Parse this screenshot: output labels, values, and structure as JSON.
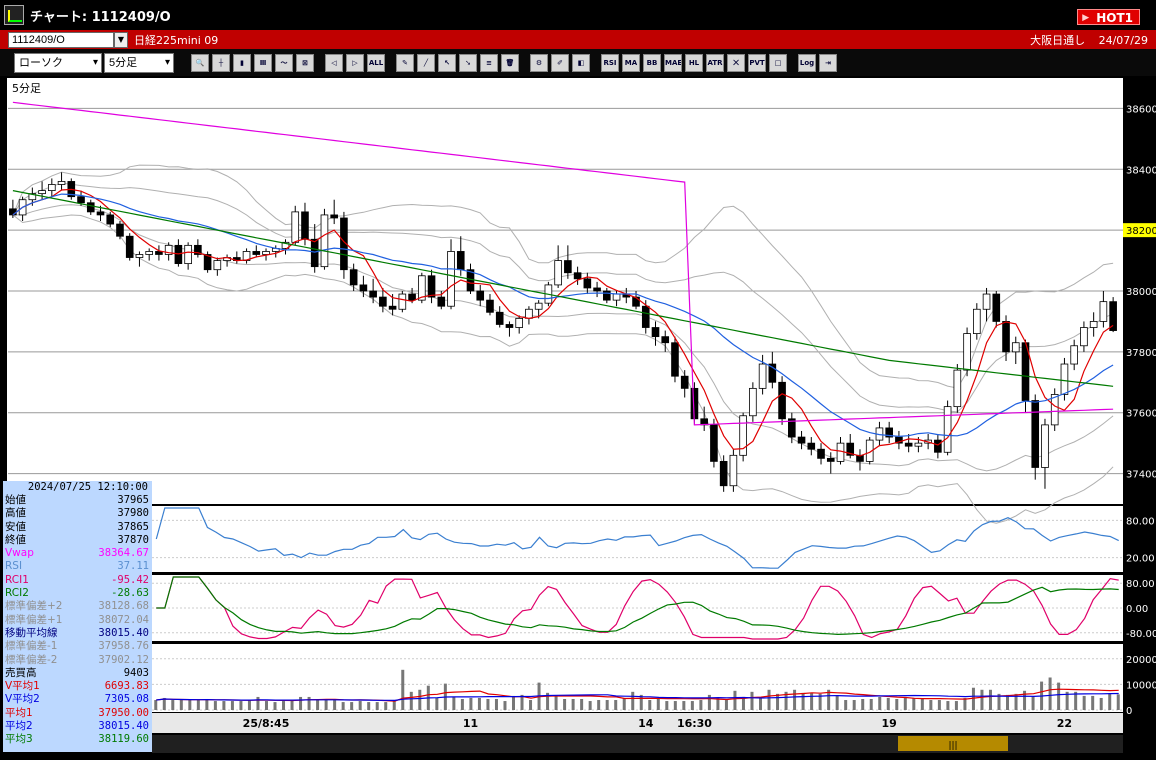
{
  "window": {
    "title": "チャート: 1112409/O",
    "hot_label": "HOT1"
  },
  "symbol_bar": {
    "code": "1112409/O",
    "name": "日経225mini 09",
    "session": "大阪日通し",
    "date": "24/07/29"
  },
  "toolbar": {
    "chart_type": "ローソク",
    "interval": "5分足",
    "buttons": [
      "zoom",
      "cross",
      "candle",
      "bar",
      "line",
      "lock",
      "cutL",
      "cutR",
      "ALL",
      "pen",
      "line-tool",
      "cursor",
      "arrow",
      "memo",
      "trash",
      "gear",
      "brush",
      "color",
      "RSI",
      "MA",
      "BB",
      "MAE",
      "HL",
      "ATR",
      "CROSS",
      "PVT",
      "box",
      "Log",
      "exit"
    ]
  },
  "chart_data": {
    "type": "candlestick",
    "interval_label": "5分足",
    "price_axis": {
      "ticks": [
        37400,
        37600,
        37800,
        38000,
        38200,
        38400,
        38600
      ],
      "ylim": [
        37300,
        38700
      ],
      "current": 38200
    },
    "x_labels": [
      "25/8:45",
      "11",
      "14",
      "16:30",
      "19",
      "22"
    ],
    "candles": [
      [
        38270,
        38300,
        38240,
        38250
      ],
      [
        38250,
        38310,
        38230,
        38300
      ],
      [
        38300,
        38340,
        38280,
        38320
      ],
      [
        38320,
        38360,
        38300,
        38330
      ],
      [
        38330,
        38370,
        38310,
        38350
      ],
      [
        38350,
        38390,
        38330,
        38360
      ],
      [
        38360,
        38370,
        38300,
        38310
      ],
      [
        38310,
        38330,
        38280,
        38290
      ],
      [
        38290,
        38300,
        38250,
        38260
      ],
      [
        38260,
        38280,
        38230,
        38250
      ],
      [
        38250,
        38260,
        38210,
        38220
      ],
      [
        38220,
        38230,
        38170,
        38180
      ],
      [
        38180,
        38190,
        38100,
        38110
      ],
      [
        38110,
        38130,
        38080,
        38120
      ],
      [
        38120,
        38140,
        38100,
        38130
      ],
      [
        38130,
        38150,
        38100,
        38120
      ],
      [
        38120,
        38160,
        38100,
        38150
      ],
      [
        38150,
        38170,
        38080,
        38090
      ],
      [
        38090,
        38160,
        38070,
        38150
      ],
      [
        38150,
        38170,
        38110,
        38120
      ],
      [
        38120,
        38130,
        38060,
        38070
      ],
      [
        38070,
        38110,
        38050,
        38100
      ],
      [
        38100,
        38120,
        38080,
        38110
      ],
      [
        38110,
        38130,
        38090,
        38100
      ],
      [
        38100,
        38140,
        38090,
        38130
      ],
      [
        38130,
        38150,
        38110,
        38120
      ],
      [
        38120,
        38140,
        38100,
        38130
      ],
      [
        38130,
        38150,
        38110,
        38140
      ],
      [
        38140,
        38170,
        38120,
        38160
      ],
      [
        38160,
        38280,
        38150,
        38260
      ],
      [
        38260,
        38290,
        38150,
        38170
      ],
      [
        38170,
        38220,
        38060,
        38080
      ],
      [
        38080,
        38270,
        38070,
        38250
      ],
      [
        38250,
        38300,
        38220,
        38240
      ],
      [
        38240,
        38260,
        38040,
        38070
      ],
      [
        38070,
        38090,
        38000,
        38020
      ],
      [
        38020,
        38050,
        37980,
        38000
      ],
      [
        38000,
        38040,
        37960,
        37980
      ],
      [
        37980,
        38010,
        37930,
        37950
      ],
      [
        37950,
        37990,
        37920,
        37940
      ],
      [
        37940,
        38000,
        37930,
        37990
      ],
      [
        37990,
        38010,
        37960,
        37970
      ],
      [
        37970,
        38060,
        37960,
        38050
      ],
      [
        38050,
        38070,
        37960,
        37980
      ],
      [
        37980,
        38000,
        37940,
        37950
      ],
      [
        37950,
        38170,
        37940,
        38130
      ],
      [
        38130,
        38180,
        38050,
        38070
      ],
      [
        38070,
        38090,
        37990,
        38000
      ],
      [
        38000,
        38020,
        37950,
        37970
      ],
      [
        37970,
        37990,
        37920,
        37930
      ],
      [
        37930,
        37950,
        37880,
        37890
      ],
      [
        37890,
        37900,
        37850,
        37880
      ],
      [
        37880,
        37920,
        37860,
        37910
      ],
      [
        37910,
        37950,
        37890,
        37940
      ],
      [
        37940,
        37970,
        37910,
        37960
      ],
      [
        37960,
        38030,
        37950,
        38020
      ],
      [
        38020,
        38150,
        38010,
        38100
      ],
      [
        38100,
        38150,
        38040,
        38060
      ],
      [
        38060,
        38080,
        38020,
        38040
      ],
      [
        38040,
        38060,
        37990,
        38010
      ],
      [
        38010,
        38030,
        37980,
        38000
      ],
      [
        38000,
        38010,
        37960,
        37970
      ],
      [
        37970,
        38000,
        37950,
        37990
      ],
      [
        37990,
        38010,
        37960,
        37980
      ],
      [
        37980,
        38000,
        37940,
        37950
      ],
      [
        37950,
        37970,
        37860,
        37880
      ],
      [
        37880,
        37900,
        37820,
        37850
      ],
      [
        37850,
        37870,
        37800,
        37830
      ],
      [
        37830,
        37850,
        37700,
        37720
      ],
      [
        37720,
        37740,
        37650,
        37680
      ],
      [
        37680,
        37700,
        37560,
        37580
      ],
      [
        37580,
        37620,
        37540,
        37560
      ],
      [
        37560,
        37580,
        37420,
        37440
      ],
      [
        37440,
        37460,
        37340,
        37360
      ],
      [
        37360,
        37480,
        37340,
        37460
      ],
      [
        37460,
        37600,
        37440,
        37590
      ],
      [
        37590,
        37700,
        37570,
        37680
      ],
      [
        37680,
        37790,
        37660,
        37760
      ],
      [
        37760,
        37800,
        37680,
        37700
      ],
      [
        37700,
        37720,
        37560,
        37580
      ],
      [
        37580,
        37600,
        37500,
        37520
      ],
      [
        37520,
        37540,
        37480,
        37500
      ],
      [
        37500,
        37520,
        37460,
        37480
      ],
      [
        37480,
        37500,
        37430,
        37450
      ],
      [
        37450,
        37470,
        37400,
        37440
      ],
      [
        37440,
        37520,
        37430,
        37500
      ],
      [
        37500,
        37530,
        37450,
        37460
      ],
      [
        37460,
        37480,
        37410,
        37440
      ],
      [
        37440,
        37520,
        37430,
        37510
      ],
      [
        37510,
        37570,
        37490,
        37550
      ],
      [
        37550,
        37570,
        37500,
        37520
      ],
      [
        37520,
        37540,
        37480,
        37500
      ],
      [
        37500,
        37530,
        37470,
        37490
      ],
      [
        37490,
        37520,
        37470,
        37500
      ],
      [
        37500,
        37530,
        37480,
        37510
      ],
      [
        37510,
        37530,
        37450,
        37470
      ],
      [
        37470,
        37640,
        37460,
        37620
      ],
      [
        37620,
        37760,
        37600,
        37740
      ],
      [
        37740,
        37880,
        37720,
        37860
      ],
      [
        37860,
        37960,
        37840,
        37940
      ],
      [
        37940,
        38010,
        37900,
        37990
      ],
      [
        37990,
        38000,
        37880,
        37900
      ],
      [
        37900,
        37920,
        37770,
        37800
      ],
      [
        37800,
        37850,
        37760,
        37830
      ],
      [
        37830,
        37840,
        37600,
        37640
      ],
      [
        37640,
        37660,
        37380,
        37420
      ],
      [
        37420,
        37580,
        37350,
        37560
      ],
      [
        37560,
        37680,
        37540,
        37660
      ],
      [
        37660,
        37780,
        37640,
        37760
      ],
      [
        37760,
        37840,
        37740,
        37820
      ],
      [
        37820,
        37900,
        37800,
        37880
      ],
      [
        37880,
        37930,
        37850,
        37900
      ],
      [
        37900,
        38000,
        37880,
        37965
      ],
      [
        37965,
        37980,
        37865,
        37870
      ]
    ],
    "indicators": {
      "rsi_ticks": [
        80,
        20
      ],
      "rci_ticks": [
        80,
        0,
        -80
      ],
      "volume_ticks": [
        20000,
        10000,
        0
      ]
    }
  },
  "info_panel": {
    "datetime": "2024/07/25  12:10:00",
    "rows": [
      {
        "label": "始値",
        "value": "37965",
        "color": "#000000"
      },
      {
        "label": "高値",
        "value": "37980",
        "color": "#000000"
      },
      {
        "label": "安値",
        "value": "37865",
        "color": "#000000"
      },
      {
        "label": "終値",
        "value": "37870",
        "color": "#000000"
      },
      {
        "label": "Vwap",
        "value": "38364.67",
        "color": "#ff00ff"
      },
      {
        "label": "RSI",
        "value": "37.11",
        "color": "#5a8fd0"
      },
      {
        "label": "RCI1",
        "value": "-95.42",
        "color": "#e0006a"
      },
      {
        "label": "RCI2",
        "value": "-28.63",
        "color": "#007a00"
      },
      {
        "label": "標準偏差+2",
        "value": "38128.68",
        "color": "#909090"
      },
      {
        "label": "標準偏差+1",
        "value": "38072.04",
        "color": "#909090"
      },
      {
        "label": "移動平均線",
        "value": "38015.40",
        "color": "#000080"
      },
      {
        "label": "標準偏差-1",
        "value": "37958.76",
        "color": "#909090"
      },
      {
        "label": "標準偏差-2",
        "value": "37902.12",
        "color": "#909090"
      },
      {
        "label": "売買高",
        "value": "9403",
        "color": "#000000"
      },
      {
        "label": "V平均1",
        "value": "6693.83",
        "color": "#e00000"
      },
      {
        "label": "V平均2",
        "value": "7305.08",
        "color": "#0000e0"
      },
      {
        "label": "平均1",
        "value": "37950.00",
        "color": "#e00000"
      },
      {
        "label": "平均2",
        "value": "38015.40",
        "color": "#0000e0"
      },
      {
        "label": "平均3",
        "value": "38119.60",
        "color": "#007a00"
      }
    ]
  }
}
